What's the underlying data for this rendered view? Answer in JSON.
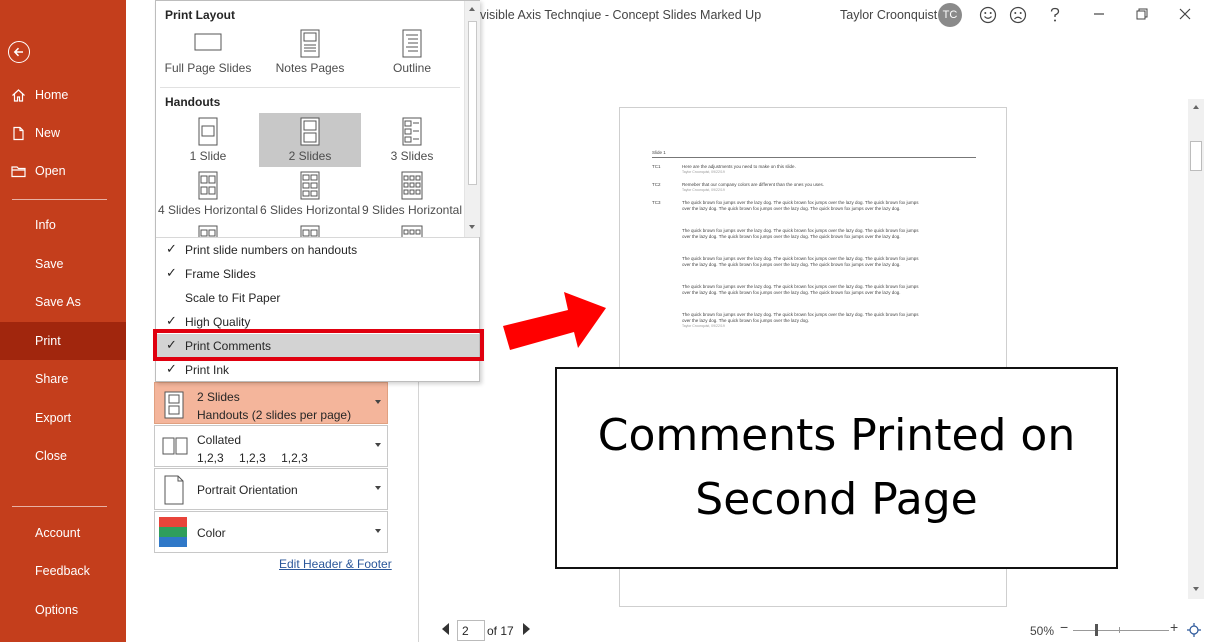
{
  "sidebar": {
    "items": [
      {
        "label": "Home",
        "icon": "home-icon"
      },
      {
        "label": "New",
        "icon": "new-doc-icon"
      },
      {
        "label": "Open",
        "icon": "folder-icon"
      },
      {
        "label": "Info"
      },
      {
        "label": "Save"
      },
      {
        "label": "Save As"
      },
      {
        "label": "Print",
        "selected": true
      },
      {
        "label": "Share"
      },
      {
        "label": "Export"
      },
      {
        "label": "Close"
      },
      {
        "label": "Account"
      },
      {
        "label": "Feedback"
      },
      {
        "label": "Options"
      }
    ]
  },
  "dropdown": {
    "print_layout_heading": "Print Layout",
    "print_layout_items": [
      "Full Page Slides",
      "Notes Pages",
      "Outline"
    ],
    "handouts_heading": "Handouts",
    "handout_items": [
      "1 Slide",
      "2 Slides",
      "3 Slides",
      "4 Slides Horizontal",
      "6 Slides Horizontal",
      "9 Slides Horizontal"
    ],
    "selected_handout": "2 Slides",
    "options": [
      {
        "label": "Print slide numbers on handouts",
        "checked": true
      },
      {
        "label": "Frame Slides",
        "checked": true
      },
      {
        "label": "Scale to Fit Paper",
        "checked": false
      },
      {
        "label": "High Quality",
        "checked": true
      },
      {
        "label": "Print Comments",
        "checked": true,
        "highlighted": true
      },
      {
        "label": "Print Ink",
        "checked": true
      }
    ],
    "check_glyph": "✓"
  },
  "settings": {
    "layout": {
      "title": "2 Slides",
      "subtitle": "Handouts (2 slides per page)"
    },
    "collate": {
      "title": "Collated",
      "sequence": [
        "1,2,3",
        "1,2,3",
        "1,2,3"
      ]
    },
    "orientation": {
      "title": "Portrait Orientation"
    },
    "color": {
      "title": "Color"
    },
    "edit_header_footer": "Edit Header & Footer"
  },
  "titlebar": {
    "doc_title": "visible Axis Technqiue - Concept Slides Marked Up",
    "user_name": "Taylor Croonquist",
    "avatar_initials": "TC"
  },
  "preview": {
    "slide_label": "Slide 1",
    "comments": [
      {
        "id": "TC1",
        "text": "Here are the adjustments you need to make on this slide.",
        "meta": "Taylor Croonquist, 09/22/19"
      },
      {
        "id": "TC2",
        "text": "Remeber that our company colors are different than the ones you uses.",
        "meta": "Taylor Croonquist, 09/22/19"
      },
      {
        "id": "TC3",
        "text": "The quick brown fox jumps over the lazy dog. The quick brown fox jumps over the lazy dog. The quick brown fox jumps over the lazy dog. The quick brown fox jumps over the lazy dog. The quick brown fox jumps over the lazy dog.",
        "meta": ""
      }
    ],
    "paragraphs": [
      "The quick brown fox jumps over the lazy dog. The quick brown fox jumps over the lazy dog. The quick brown fox jumps over the lazy dog. The quick brown fox jumps over the lazy dog. The quick brown fox jumps over the lazy dog.",
      "The quick brown fox jumps over the lazy dog. The quick brown fox jumps over the lazy dog. The quick brown fox jumps over the lazy dog. The quick brown fox jumps over the lazy dog. The quick brown fox jumps over the lazy dog.",
      "The quick brown fox jumps over the lazy dog. The quick brown fox jumps over the lazy dog. The quick brown fox jumps over the lazy dog. The quick brown fox jumps over the lazy dog. The quick brown fox jumps over the lazy dog.",
      "The quick brown fox jumps over the lazy dog. The quick brown fox jumps over the lazy dog. The quick brown fox jumps over the lazy dog. The quick brown fox jumps over the lazy dog."
    ],
    "last_meta": "Taylor Croonquist, 09/22/19"
  },
  "callout": {
    "line1": "Comments Printed on",
    "line2": "Second Page"
  },
  "nav": {
    "page": "2",
    "of_label": "of 17",
    "zoom": "50%",
    "minus": "−",
    "plus": "+"
  },
  "colors": {
    "sidebar_bg": "#c43e1c",
    "sidebar_selected": "#a1260d",
    "active_setting": "#f4b59b",
    "highlight_red": "#e0000f",
    "arrow_red": "#ff0000"
  }
}
